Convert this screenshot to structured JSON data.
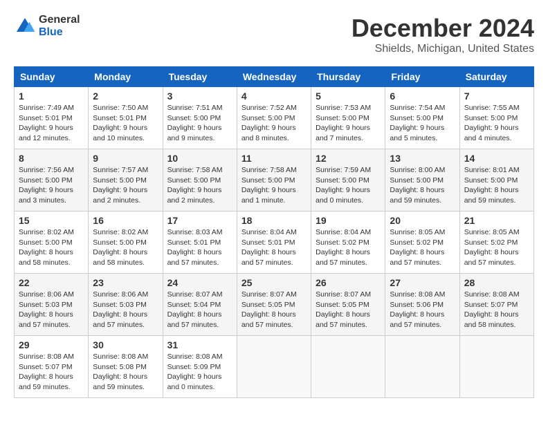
{
  "logo": {
    "general": "General",
    "blue": "Blue"
  },
  "title": "December 2024",
  "subtitle": "Shields, Michigan, United States",
  "days_of_week": [
    "Sunday",
    "Monday",
    "Tuesday",
    "Wednesday",
    "Thursday",
    "Friday",
    "Saturday"
  ],
  "weeks": [
    [
      {
        "day": "1",
        "sunrise": "7:49 AM",
        "sunset": "5:01 PM",
        "daylight": "9 hours and 12 minutes."
      },
      {
        "day": "2",
        "sunrise": "7:50 AM",
        "sunset": "5:01 PM",
        "daylight": "9 hours and 10 minutes."
      },
      {
        "day": "3",
        "sunrise": "7:51 AM",
        "sunset": "5:00 PM",
        "daylight": "9 hours and 9 minutes."
      },
      {
        "day": "4",
        "sunrise": "7:52 AM",
        "sunset": "5:00 PM",
        "daylight": "9 hours and 8 minutes."
      },
      {
        "day": "5",
        "sunrise": "7:53 AM",
        "sunset": "5:00 PM",
        "daylight": "9 hours and 7 minutes."
      },
      {
        "day": "6",
        "sunrise": "7:54 AM",
        "sunset": "5:00 PM",
        "daylight": "9 hours and 5 minutes."
      },
      {
        "day": "7",
        "sunrise": "7:55 AM",
        "sunset": "5:00 PM",
        "daylight": "9 hours and 4 minutes."
      }
    ],
    [
      {
        "day": "8",
        "sunrise": "7:56 AM",
        "sunset": "5:00 PM",
        "daylight": "9 hours and 3 minutes."
      },
      {
        "day": "9",
        "sunrise": "7:57 AM",
        "sunset": "5:00 PM",
        "daylight": "9 hours and 2 minutes."
      },
      {
        "day": "10",
        "sunrise": "7:58 AM",
        "sunset": "5:00 PM",
        "daylight": "9 hours and 2 minutes."
      },
      {
        "day": "11",
        "sunrise": "7:58 AM",
        "sunset": "5:00 PM",
        "daylight": "9 hours and 1 minute."
      },
      {
        "day": "12",
        "sunrise": "7:59 AM",
        "sunset": "5:00 PM",
        "daylight": "9 hours and 0 minutes."
      },
      {
        "day": "13",
        "sunrise": "8:00 AM",
        "sunset": "5:00 PM",
        "daylight": "8 hours and 59 minutes."
      },
      {
        "day": "14",
        "sunrise": "8:01 AM",
        "sunset": "5:00 PM",
        "daylight": "8 hours and 59 minutes."
      }
    ],
    [
      {
        "day": "15",
        "sunrise": "8:02 AM",
        "sunset": "5:00 PM",
        "daylight": "8 hours and 58 minutes."
      },
      {
        "day": "16",
        "sunrise": "8:02 AM",
        "sunset": "5:00 PM",
        "daylight": "8 hours and 58 minutes."
      },
      {
        "day": "17",
        "sunrise": "8:03 AM",
        "sunset": "5:01 PM",
        "daylight": "8 hours and 57 minutes."
      },
      {
        "day": "18",
        "sunrise": "8:04 AM",
        "sunset": "5:01 PM",
        "daylight": "8 hours and 57 minutes."
      },
      {
        "day": "19",
        "sunrise": "8:04 AM",
        "sunset": "5:02 PM",
        "daylight": "8 hours and 57 minutes."
      },
      {
        "day": "20",
        "sunrise": "8:05 AM",
        "sunset": "5:02 PM",
        "daylight": "8 hours and 57 minutes."
      },
      {
        "day": "21",
        "sunrise": "8:05 AM",
        "sunset": "5:02 PM",
        "daylight": "8 hours and 57 minutes."
      }
    ],
    [
      {
        "day": "22",
        "sunrise": "8:06 AM",
        "sunset": "5:03 PM",
        "daylight": "8 hours and 57 minutes."
      },
      {
        "day": "23",
        "sunrise": "8:06 AM",
        "sunset": "5:03 PM",
        "daylight": "8 hours and 57 minutes."
      },
      {
        "day": "24",
        "sunrise": "8:07 AM",
        "sunset": "5:04 PM",
        "daylight": "8 hours and 57 minutes."
      },
      {
        "day": "25",
        "sunrise": "8:07 AM",
        "sunset": "5:05 PM",
        "daylight": "8 hours and 57 minutes."
      },
      {
        "day": "26",
        "sunrise": "8:07 AM",
        "sunset": "5:05 PM",
        "daylight": "8 hours and 57 minutes."
      },
      {
        "day": "27",
        "sunrise": "8:08 AM",
        "sunset": "5:06 PM",
        "daylight": "8 hours and 57 minutes."
      },
      {
        "day": "28",
        "sunrise": "8:08 AM",
        "sunset": "5:07 PM",
        "daylight": "8 hours and 58 minutes."
      }
    ],
    [
      {
        "day": "29",
        "sunrise": "8:08 AM",
        "sunset": "5:07 PM",
        "daylight": "8 hours and 59 minutes."
      },
      {
        "day": "30",
        "sunrise": "8:08 AM",
        "sunset": "5:08 PM",
        "daylight": "8 hours and 59 minutes."
      },
      {
        "day": "31",
        "sunrise": "8:08 AM",
        "sunset": "5:09 PM",
        "daylight": "9 hours and 0 minutes."
      },
      null,
      null,
      null,
      null
    ]
  ],
  "labels": {
    "sunrise": "Sunrise:",
    "sunset": "Sunset:",
    "daylight": "Daylight:"
  }
}
